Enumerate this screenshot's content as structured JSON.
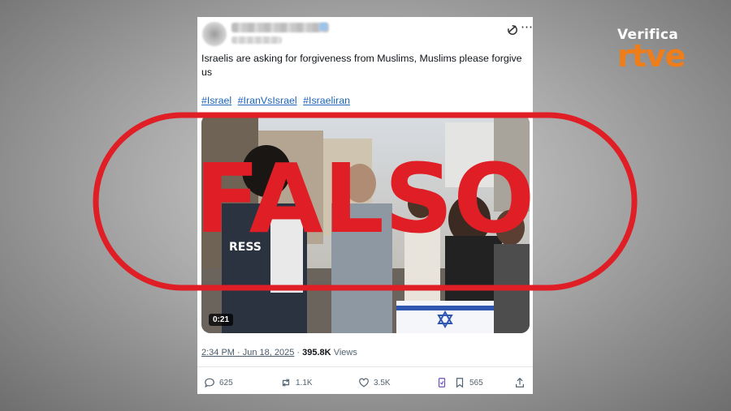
{
  "brand": {
    "top": "Verifica",
    "bottom": "rtve",
    "accent_color": "#ef7d1a"
  },
  "tweet": {
    "text": "Israelis are asking for forgiveness from Muslims, Muslims please forgive us",
    "hashtags": [
      "#Israel",
      "#IranVsIsrael",
      "#Israeliran"
    ],
    "video_duration": "0:21",
    "timestamp": "2:34 PM · Jun 18, 2025",
    "separator": " · ",
    "views_count": "395.8K",
    "views_label": "Views",
    "actions": {
      "replies": "625",
      "reposts": "1.1K",
      "likes": "3.5K",
      "bookmarks": "565"
    },
    "link_color": "#1d64b9"
  },
  "stamp": {
    "text": "FALSO",
    "color": "#e01e26"
  }
}
